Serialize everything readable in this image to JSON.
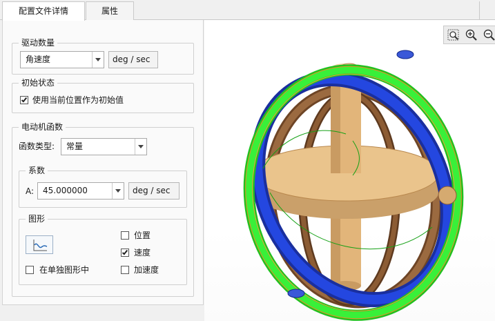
{
  "tabs": [
    {
      "label": "配置文件详情",
      "active": true
    },
    {
      "label": "属性",
      "active": false
    }
  ],
  "drive_quantity": {
    "title": "驱动数量",
    "selected": "角速度",
    "unit": "deg / sec"
  },
  "initial_state": {
    "title": "初始状态",
    "use_current_label": "使用当前位置作为初始值",
    "use_current_checked": true
  },
  "motor_function": {
    "title": "电动机函数",
    "function_type_label": "函数类型:",
    "function_type_value": "常量",
    "coefficients": {
      "title": "系数",
      "a_label": "A:",
      "a_value": "45.000000",
      "a_unit": "deg / sec"
    },
    "graph": {
      "title": "图形",
      "separate_graph_label": "在单独图形中",
      "separate_graph_checked": false,
      "position_label": "位置",
      "position_checked": false,
      "velocity_label": "速度",
      "velocity_checked": true,
      "acceleration_label": "加速度",
      "acceleration_checked": false
    }
  },
  "viewport": {
    "zoom_tools": [
      "zoom-window-icon",
      "zoom-in-icon",
      "zoom-out-icon"
    ],
    "colors": {
      "green_ring": "#2ee82e",
      "blue_ring": "#1f3fd6",
      "bronze_ring": "#8a5a34",
      "tan_body": "#e7bd82"
    }
  }
}
